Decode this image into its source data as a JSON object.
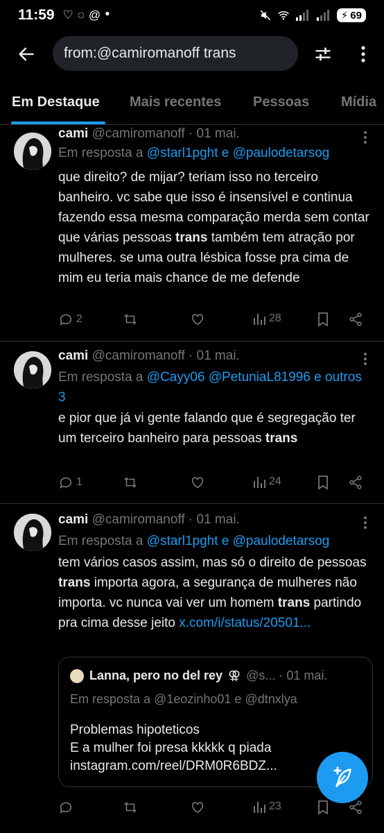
{
  "status_bar": {
    "time": "11:59",
    "left_icons": [
      "heart-outline-icon",
      "whatsapp-icon",
      "at-icon",
      "dot-icon"
    ],
    "battery": "69"
  },
  "search": {
    "query": "from:@camiromanoff trans"
  },
  "tabs": [
    {
      "label": "Em Destaque",
      "active": true
    },
    {
      "label": "Mais recentes",
      "active": false
    },
    {
      "label": "Pessoas",
      "active": false
    },
    {
      "label": "Mídia",
      "active": false
    }
  ],
  "tweets": [
    {
      "name": "cami",
      "meta": "@camiromanoff · 01 mai.",
      "reply_prefix": "Em resposta a ",
      "reply_mentions": "@starl1pght e @paulodetarsog",
      "text_parts": [
        "que direito? de mijar? teriam isso no terceiro banheiro. vc sabe que isso é insensível e continua fazendo essa mesma comparação merda sem contar que várias pessoas ",
        "trans",
        " também tem atração por mulheres. se uma outra lésbica fosse pra cima de mim eu teria mais chance de me defende"
      ],
      "replies": "2",
      "views": "28"
    },
    {
      "name": "cami",
      "meta": "@camiromanoff · 01 mai.",
      "reply_prefix": "Em resposta a ",
      "reply_mentions": "@Cayy06 @PetuniaL81996 e outros 3",
      "text_parts": [
        "e pior que já vi gente falando que é segregação ter um terceiro banheiro para pessoas ",
        "trans",
        ""
      ],
      "replies": "1",
      "views": "24"
    },
    {
      "name": "cami",
      "meta": "@camiromanoff · 01 mai.",
      "reply_prefix": "Em resposta a ",
      "reply_mentions": "@starl1pght e @paulodetarsog",
      "text_parts": [
        "tem vários casos assim, mas só o direito de pessoas ",
        "trans",
        " importa agora, a segurança de mulheres não importa. vc nunca vai ver um homem ",
        "trans",
        " partindo pra cima desse jeito "
      ],
      "link": "x.com/i/status/20501...",
      "replies": "",
      "views": "23",
      "quote": {
        "name": "Lanna, pero no del rey",
        "meta": "@s... · 01 mai.",
        "reply": "Em resposta a @1eozinho01 e @dtnxlya",
        "lines": [
          "Problemas hipoteticos",
          "E a mulher foi presa kkkkk q piada",
          "instagram.com/reel/DRM0R6BDZ..."
        ]
      }
    }
  ],
  "colors": {
    "accent": "#1d9bf0",
    "muted": "#71767b",
    "text": "#e7e9ea",
    "background": "#000000"
  }
}
